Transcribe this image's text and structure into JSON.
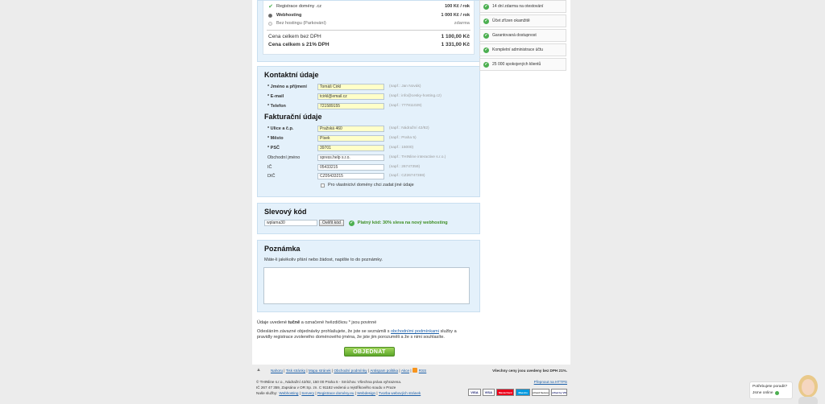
{
  "summary": {
    "items": [
      {
        "label": "Registrace domény .cz",
        "price": "100 Kč / rok"
      },
      {
        "label": "Webhosting",
        "price": "1 000 Kč / rok"
      },
      {
        "label": "Bez hostingu (Parkování)",
        "price": "zdarma"
      }
    ],
    "total_no_vat_label": "Cena celkem bez DPH",
    "total_no_vat": "1 100,00 Kč",
    "total_vat_label": "Cena celkem s 21% DPH",
    "total_vat": "1 331,00 Kč"
  },
  "benefits": [
    "14 dní zdarma na otestování",
    "Účet zřízen okamžitě",
    "Garantovaná dostupnost",
    "Kompletní administrace účtu",
    "25 000 spokojených klientů"
  ],
  "contact": {
    "title": "Kontaktní údaje",
    "fields": [
      {
        "label": "* Jméno a příjmení",
        "value": "Tomáš Cirkl",
        "hint": "(např.: Jan Novák)"
      },
      {
        "label": "* E-mail",
        "value": "tcirkl@email.cz",
        "hint": "(např.: info@cesky-hosting.cz)"
      },
      {
        "label": "* Telefon",
        "value": "721589155",
        "hint": "(např.: 777811029)"
      }
    ]
  },
  "billing": {
    "title": "Fakturační údaje",
    "fields": [
      {
        "label": "* Ulice a č.p.",
        "value": "Pražská 460",
        "hint": "(např.: Nádražní 42/82)"
      },
      {
        "label": "* Město",
        "value": "Písek",
        "hint": "(např.: Praha 5)"
      },
      {
        "label": "* PSČ",
        "value": "39701",
        "hint": "(např.: 15000)"
      },
      {
        "label": "Obchodní jméno",
        "value": "xpress.help s.r.o.",
        "hint": "(např.: THINline interactive s.r.o.)"
      },
      {
        "label": "IČ",
        "value": "05433215",
        "hint": "(např.: 26747359)"
      },
      {
        "label": "DIČ",
        "value": "CZ05433215",
        "hint": "(např.: CZ26747359)"
      }
    ],
    "checkbox_label": "Pro vlastnictví domény chci zadat jiné údaje"
  },
  "discount": {
    "title": "Slevový kód",
    "value": "wplama30",
    "button": "Ověřit kód",
    "status": "Platný kód: 30% sleva na nový webhosting"
  },
  "note": {
    "title": "Poznámka",
    "description": "Máte-li jakékoliv přání nebo žádost, napište to do poznámky."
  },
  "legal": {
    "required_prefix": "Údaje uvedené",
    "required_bold": "tučně",
    "required_suffix": "a označené hvězdičkou * jsou povinné",
    "agree_prefix": "Odesláním závazné objednávky prohlašujete, že jste se seznámili s",
    "agree_link": "obchodními podmínkami",
    "agree_suffix": "služby a pravidly registrace zvoleného doménového jména, že jste jim porozuměli a že s nimi souhlasíte."
  },
  "order_button": "OBJEDNAT",
  "footer": {
    "top_arrow": "▲",
    "links": [
      "Nahoru",
      "Tisk stránky",
      "Mapa stránek",
      "Obchodní podmínky",
      "Antispam politika",
      "Akce",
      "RSS"
    ],
    "vat_note": "Všechny ceny jsou uvedeny bez DPH 21%.",
    "company_line1": "© THINline s.r.o., Nádražní 42/82, 150 00 Praha 5 - Smíchov. Všechna práva vyhrazena.",
    "company_line2": "IČ 267 47 359, Zapsána v OR Sp. zn. C 91182 vedená u rejstříkového soudu v Praze",
    "services_prefix": "Naše služby:",
    "services": [
      "Webhosting",
      "Servery",
      "Registrace domény.eu",
      "Webdesign",
      "Tvorba webových stránek"
    ],
    "https_link": "Přepnout na HTTPS",
    "cards": [
      "VISA",
      "VISA",
      "MasterCard",
      "Maestro",
      "MasterCard SecureCode",
      "Verified by VISA"
    ]
  },
  "chat": {
    "question": "Potřebujete poradit?",
    "status": "Jsme online"
  }
}
